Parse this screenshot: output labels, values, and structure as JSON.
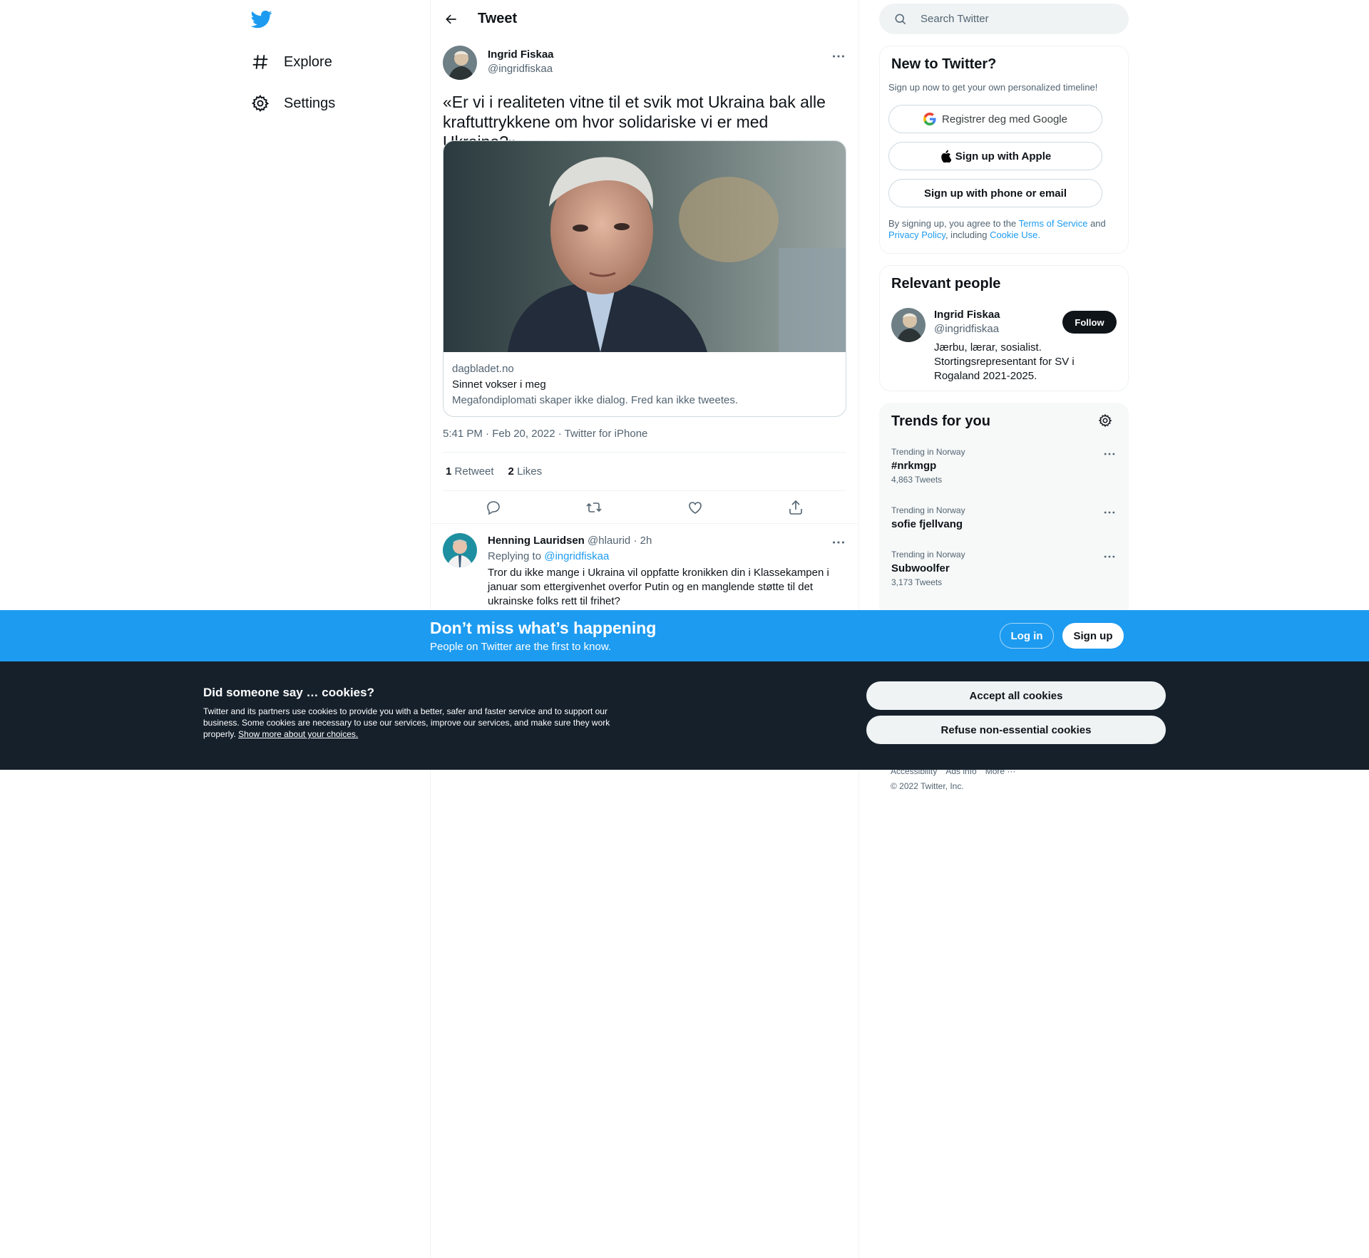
{
  "nav": {
    "items": [
      {
        "label": "Explore",
        "icon": "hashtag-icon"
      },
      {
        "label": "Settings",
        "icon": "gear-icon"
      }
    ]
  },
  "header": {
    "title": "Tweet"
  },
  "tweet": {
    "author_name": "Ingrid Fiskaa",
    "author_handle": "@ingridfiskaa",
    "text": "«Er vi i realiteten vitne til et svik mot Ukraina bak alle kraftuttrykkene om hvor solidariske vi er med Ukraina?»",
    "card": {
      "domain": "dagbladet.no",
      "title": "Sinnet vokser i meg",
      "description": "Megafondiplomati skaper ikke dialog. Fred kan ikke tweetes."
    },
    "timestamp": "5:41 PM · Feb 20, 2022 · Twitter for iPhone",
    "retweets_count": "1",
    "retweets_label": "Retweet",
    "likes_count": "2",
    "likes_label": "Likes"
  },
  "reply": {
    "author_name": "Henning Lauridsen",
    "author_handle": "@hlaurid",
    "time": "· 2h",
    "replying_prefix": "Replying to",
    "replying_to": "@ingridfiskaa",
    "text": "Tror du ikke mange i Ukraina vil oppfatte kronikken din i Klassekampen i januar som ettergivenhet overfor Putin og en manglende støtte til det ukrainske folks rett til frihet?"
  },
  "search": {
    "placeholder": "Search Twitter"
  },
  "new_to_twitter": {
    "title": "New to Twitter?",
    "subtitle": "Sign up now to get your own personalized timeline!",
    "google_label": "Registrer deg med Google",
    "apple_label": "Sign up with Apple",
    "phone_label": "Sign up with phone or email",
    "terms_prefix": "By signing up, you agree to the",
    "terms_link": "Terms of Service",
    "terms_and": "and",
    "privacy_link": "Privacy Policy",
    "terms_including": ", including",
    "cookie_link": "Cookie Use."
  },
  "relevant_people": {
    "title": "Relevant people",
    "name": "Ingrid Fiskaa",
    "handle": "@ingridfiskaa",
    "follow_label": "Follow",
    "bio": "Jærbu, lærar, sosialist. Stortingsrepresentant for SV i Rogaland 2021-2025."
  },
  "trends": {
    "title": "Trends for you",
    "items": [
      {
        "context": "Trending in Norway",
        "name": "#nrkmgp",
        "count": "4,863 Tweets"
      },
      {
        "context": "Trending in Norway",
        "name": "sofie fjellvang",
        "count": ""
      },
      {
        "context": "Trending in Norway",
        "name": "Subwoolfer",
        "count": "3,173 Tweets"
      }
    ]
  },
  "footer": {
    "links": [
      "Accessibility",
      "Ads info",
      "More ···"
    ],
    "copyright": "© 2022 Twitter, Inc."
  },
  "signup_bar": {
    "title": "Don’t miss what’s happening",
    "subtitle": "People on Twitter are the first to know.",
    "login_label": "Log in",
    "signup_label": "Sign up"
  },
  "cookies": {
    "title": "Did someone say … cookies?",
    "text": "Twitter and its partners use cookies to provide you with a better, safer and faster service and to support our business. Some cookies are necessary to use our services, improve our services, and make sure they work properly.",
    "link": "Show more about your choices.",
    "accept_label": "Accept all cookies",
    "refuse_label": "Refuse non-essential cookies"
  },
  "colors": {
    "brand": "#1d9bf0",
    "text": "#0f1419",
    "muted": "#536471",
    "cookie_bg": "#15202b"
  }
}
